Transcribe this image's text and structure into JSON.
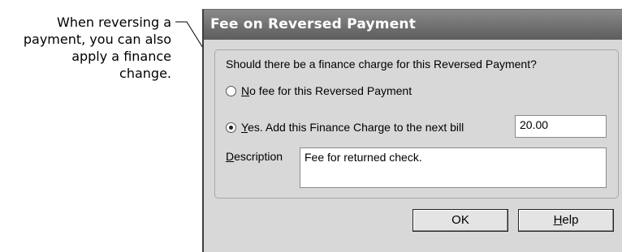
{
  "callout": {
    "line1": "When reversing a",
    "line2": "payment, you can also",
    "line3": "apply a finance",
    "line4": "change."
  },
  "dialog": {
    "title": "Fee on Reversed Payment",
    "question": "Should there be a finance charge for this Reversed Payment?",
    "option_no": {
      "accel": "N",
      "rest": "o fee for this Reversed Payment",
      "selected": false
    },
    "option_yes": {
      "accel": "Y",
      "rest": "es. Add this Finance Charge to the next bill",
      "selected": true
    },
    "fee_value": "20.00",
    "description_label": {
      "accel": "D",
      "rest": "escription"
    },
    "description_value": "Fee for returned check.",
    "ok_label": "OK",
    "help_label": {
      "accel": "H",
      "rest": "elp"
    }
  }
}
